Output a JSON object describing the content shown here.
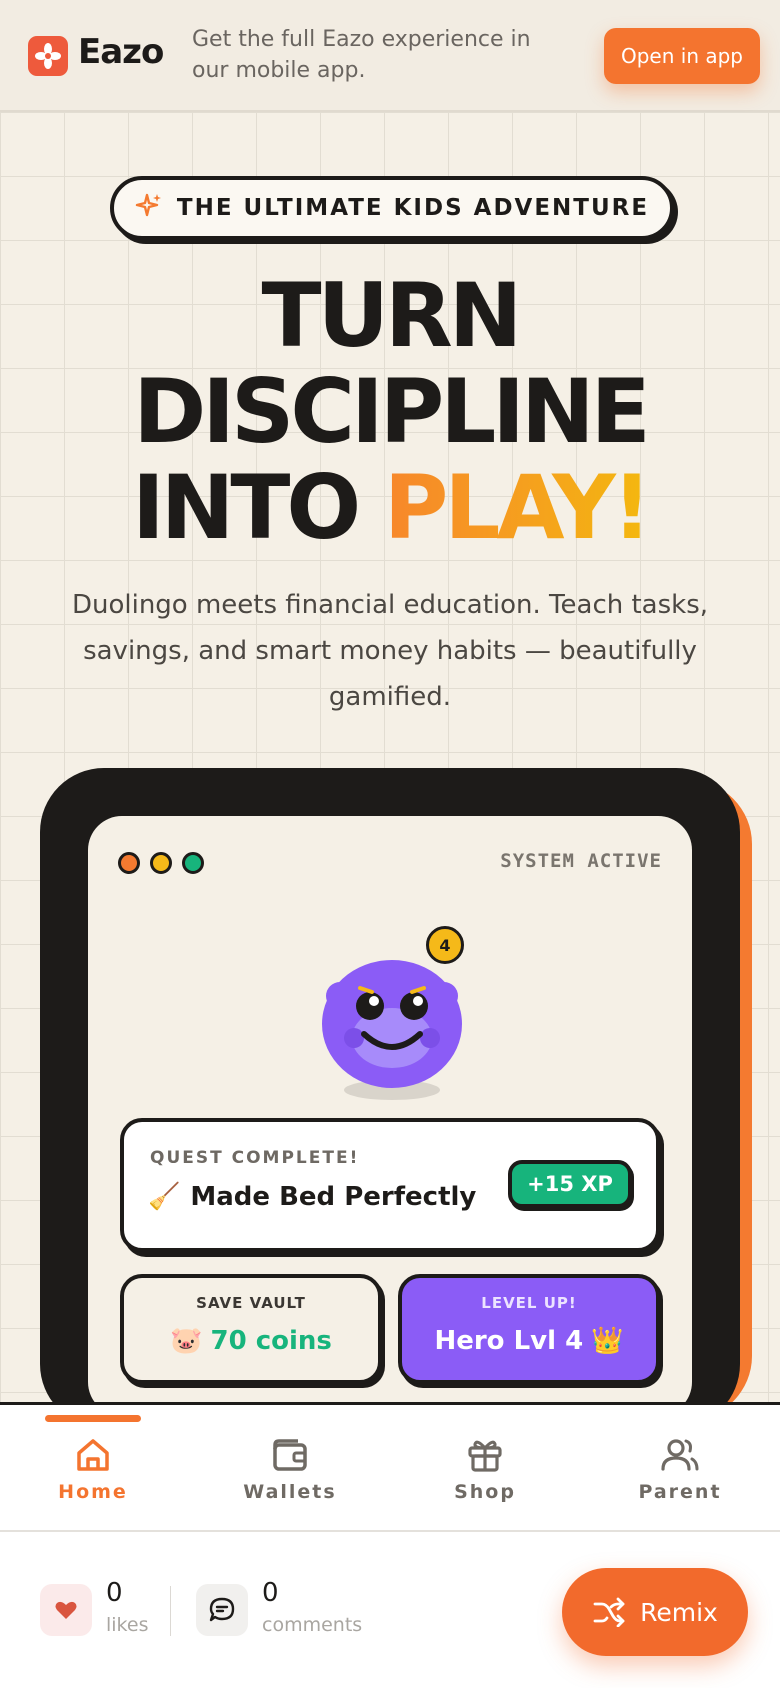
{
  "banner": {
    "brand": "Eazo",
    "message": "Get the full Eazo experience in our mobile app.",
    "open_button": "Open in app"
  },
  "hero": {
    "tagline": "THE ULTIMATE KIDS ADVENTURE",
    "headline_line1": "TURN",
    "headline_line2": "DISCIPLINE",
    "headline_line3_plain": "INTO ",
    "headline_line3_accent": "PLAY!",
    "subtext": "Duolingo meets financial education. Teach tasks, savings, and smart money habits — beautifully gamified."
  },
  "phone": {
    "status": "SYSTEM ACTIVE",
    "window_dots": [
      "#f47a30",
      "#f5b919",
      "#17b47c"
    ],
    "mascot_level": "4",
    "quest": {
      "label": "QUEST COMPLETE!",
      "emoji": "🧹",
      "title": "Made Bed Perfectly",
      "xp": "+15 XP"
    },
    "vault": {
      "label": "SAVE VAULT",
      "emoji": "🐷",
      "value": "70 coins"
    },
    "level_up": {
      "label": "LEVEL UP!",
      "value": "Hero Lvl 4",
      "emoji": "👑"
    }
  },
  "nav": {
    "items": [
      {
        "label": "Home",
        "icon": "home-icon",
        "active": true
      },
      {
        "label": "Wallets",
        "icon": "wallet-icon",
        "active": false
      },
      {
        "label": "Shop",
        "icon": "gift-icon",
        "active": false
      },
      {
        "label": "Parent",
        "icon": "users-icon",
        "active": false
      }
    ]
  },
  "footer": {
    "likes_count": "0",
    "likes_label": "likes",
    "comments_count": "0",
    "comments_label": "comments",
    "remix_label": "Remix"
  },
  "colors": {
    "accent": "#f4742f",
    "green": "#17b47c",
    "purple": "#8b5cf6",
    "yellow": "#f5b919",
    "ink": "#1d1b19",
    "cream": "#f5f0e6"
  }
}
